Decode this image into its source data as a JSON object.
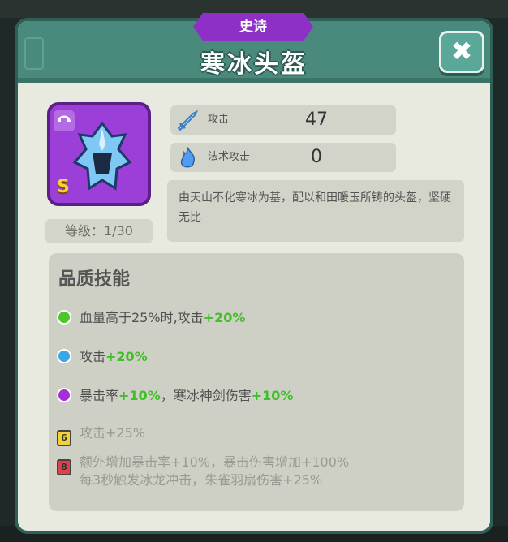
{
  "rarity": "史诗",
  "title": "寒冰头盔",
  "close_icon": "✖",
  "item": {
    "grade": "S",
    "type_icon": "helmet-icon",
    "level_label": "等级：1/30"
  },
  "stats": [
    {
      "icon": "sword-icon",
      "label": "攻击",
      "value": "47"
    },
    {
      "icon": "flame-icon",
      "label": "法术攻击",
      "value": "0"
    }
  ],
  "description": "由天山不化寒冰为基，配以和田暖玉所铸的头盔，坚硬无比",
  "skills_title": "品质技能",
  "skills": [
    {
      "color": "#4cc62a",
      "text": "血量高于25%时,攻击",
      "bonus": "+20%"
    },
    {
      "color": "#3aa6e8",
      "text": "攻击",
      "bonus": "+20%"
    },
    {
      "color": "#a52fd6",
      "text": "暴击率",
      "bonus": "+10%",
      "text2": "，寒冰神剑伤害",
      "bonus2": "+10%"
    }
  ],
  "locked_skills": [
    {
      "color": "#f2d23c",
      "lock_text": "6",
      "text": "攻击+25%"
    },
    {
      "color": "#e0404a",
      "lock_text": "8",
      "line1": "额外增加暴击率+10%，暴击伤害增加+100%",
      "line2": "每3秒触发冰龙冲击，朱雀羽扇伤害+25%"
    }
  ]
}
